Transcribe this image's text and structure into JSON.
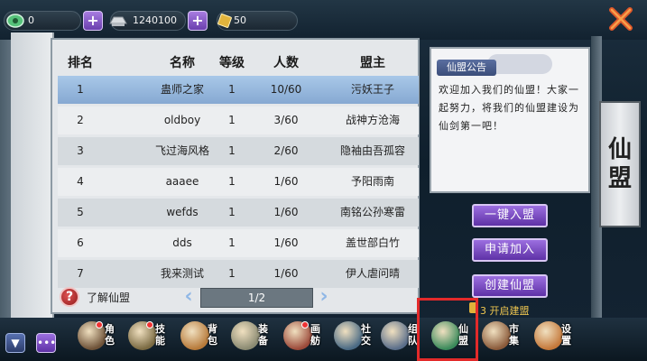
{
  "resources": {
    "jade": "0",
    "silver": "1240100",
    "tickets": "50"
  },
  "table": {
    "headers": [
      "排名",
      "名称",
      "等级",
      "人数",
      "盟主"
    ],
    "rows": [
      {
        "rank": "1",
        "name": "蛊师之家",
        "level": "1",
        "members": "10/60",
        "leader": "污妖王子"
      },
      {
        "rank": "2",
        "name": "oldboy",
        "level": "1",
        "members": "3/60",
        "leader": "战神方沧海"
      },
      {
        "rank": "3",
        "name": "飞过海风格",
        "level": "1",
        "members": "2/60",
        "leader": "隐袖由吾孤容"
      },
      {
        "rank": "4",
        "name": "aaaee",
        "level": "1",
        "members": "1/60",
        "leader": "予阳雨南"
      },
      {
        "rank": "5",
        "name": "wefds",
        "level": "1",
        "members": "1/60",
        "leader": "南铭公孙寒雷"
      },
      {
        "rank": "6",
        "name": "dds",
        "level": "1",
        "members": "1/60",
        "leader": "盖世部白竹"
      },
      {
        "rank": "7",
        "name": "我来测试",
        "level": "1",
        "members": "1/60",
        "leader": "伊人虐问晴"
      }
    ]
  },
  "help_label": "了解仙盟",
  "pagination": "1/2",
  "notice": {
    "title": "仙盟公告",
    "body": "欢迎加入我们的仙盟！大家一起努力，将我们的仙盟建设为仙剑第一吧！"
  },
  "buttons": {
    "quick_join": "一键入盟",
    "apply_join": "申请加入",
    "create": "创建仙盟",
    "unlock_note": "3 开启建盟"
  },
  "banner": "仙盟",
  "nav": [
    {
      "label": "角色",
      "icon": "character-icon",
      "dot": true
    },
    {
      "label": "技能",
      "icon": "skill-icon",
      "dot": true
    },
    {
      "label": "背包",
      "icon": "bag-icon",
      "dot": false
    },
    {
      "label": "装备",
      "icon": "equipment-icon",
      "dot": false
    },
    {
      "label": "画舫",
      "icon": "boat-icon",
      "dot": true
    },
    {
      "label": "社交",
      "icon": "social-icon",
      "dot": false
    },
    {
      "label": "组队",
      "icon": "team-icon",
      "dot": false
    },
    {
      "label": "仙盟",
      "icon": "guild-icon",
      "dot": false
    },
    {
      "label": "市集",
      "icon": "market-icon",
      "dot": false
    },
    {
      "label": "设置",
      "icon": "settings-icon",
      "dot": false
    }
  ],
  "colors": {
    "accent_purple": "#7b4fc4",
    "selected_row": "#9bbde3",
    "highlight_red": "#e32a2a"
  }
}
